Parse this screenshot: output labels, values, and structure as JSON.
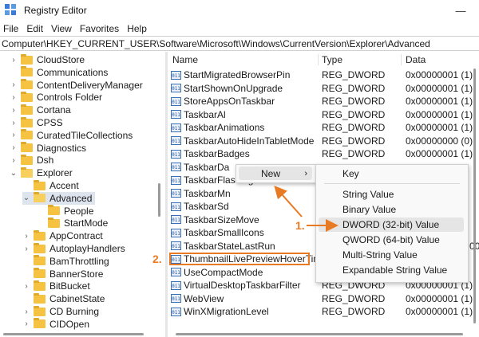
{
  "window": {
    "title": "Registry Editor"
  },
  "menu": [
    "File",
    "Edit",
    "View",
    "Favorites",
    "Help"
  ],
  "address": "Computer\\HKEY_CURRENT_USER\\Software\\Microsoft\\Windows\\CurrentVersion\\Explorer\\Advanced",
  "tree": [
    {
      "label": "CloudStore",
      "level": 0,
      "chev": "›"
    },
    {
      "label": "Communications",
      "level": 0,
      "chev": ""
    },
    {
      "label": "ContentDeliveryManager",
      "level": 0,
      "chev": "›"
    },
    {
      "label": "Controls Folder",
      "level": 0,
      "chev": "›"
    },
    {
      "label": "Cortana",
      "level": 0,
      "chev": "›"
    },
    {
      "label": "CPSS",
      "level": 0,
      "chev": "›"
    },
    {
      "label": "CuratedTileCollections",
      "level": 0,
      "chev": "›"
    },
    {
      "label": "Diagnostics",
      "level": 0,
      "chev": "›"
    },
    {
      "label": "Dsh",
      "level": 0,
      "chev": "›"
    },
    {
      "label": "Explorer",
      "level": 0,
      "chev": "⌄"
    },
    {
      "label": "Accent",
      "level": 1,
      "chev": ""
    },
    {
      "label": "Advanced",
      "level": 1,
      "chev": "⌄",
      "selected": true
    },
    {
      "label": "People",
      "level": 2,
      "chev": ""
    },
    {
      "label": "StartMode",
      "level": 2,
      "chev": ""
    },
    {
      "label": "AppContract",
      "level": 1,
      "chev": "›"
    },
    {
      "label": "AutoplayHandlers",
      "level": 1,
      "chev": "›"
    },
    {
      "label": "BamThrottling",
      "level": 1,
      "chev": ""
    },
    {
      "label": "BannerStore",
      "level": 1,
      "chev": ""
    },
    {
      "label": "BitBucket",
      "level": 1,
      "chev": "›"
    },
    {
      "label": "CabinetState",
      "level": 1,
      "chev": ""
    },
    {
      "label": "CD Burning",
      "level": 1,
      "chev": "›"
    },
    {
      "label": "CIDOpen",
      "level": 1,
      "chev": "›"
    }
  ],
  "columns": {
    "name": "Name",
    "type": "Type",
    "data": "Data"
  },
  "values": [
    {
      "name": "StartMigratedBrowserPin",
      "type": "REG_DWORD",
      "data": "0x00000001 (1)"
    },
    {
      "name": "StartShownOnUpgrade",
      "type": "REG_DWORD",
      "data": "0x00000001 (1)"
    },
    {
      "name": "StoreAppsOnTaskbar",
      "type": "REG_DWORD",
      "data": "0x00000001 (1)"
    },
    {
      "name": "TaskbarAl",
      "type": "REG_DWORD",
      "data": "0x00000001 (1)"
    },
    {
      "name": "TaskbarAnimations",
      "type": "REG_DWORD",
      "data": "0x00000001 (1)"
    },
    {
      "name": "TaskbarAutoHideInTabletMode",
      "type": "REG_DWORD",
      "data": "0x00000000 (0)"
    },
    {
      "name": "TaskbarBadges",
      "type": "REG_DWORD",
      "data": "0x00000001 (1)"
    },
    {
      "name": "TaskbarDa",
      "type": "",
      "data": ""
    },
    {
      "name": "TaskbarFlashing",
      "type": "",
      "data": ""
    },
    {
      "name": "TaskbarMn",
      "type": "",
      "data": ""
    },
    {
      "name": "TaskbarSd",
      "type": "",
      "data": ""
    },
    {
      "name": "TaskbarSizeMove",
      "type": "",
      "data": ""
    },
    {
      "name": "TaskbarSmallIcons",
      "type": "",
      "data": ""
    },
    {
      "name": "TaskbarStateLastRun",
      "type": "",
      "data": "00"
    },
    {
      "name": "ThumbnailLivePreviewHoverTime",
      "type": "",
      "data": ""
    },
    {
      "name": "UseCompactMode",
      "type": "",
      "data": ""
    },
    {
      "name": "VirtualDesktopTaskbarFilter",
      "type": "REG_DWORD",
      "data": "0x00000001 (1)"
    },
    {
      "name": "WebView",
      "type": "REG_DWORD",
      "data": "0x00000001 (1)"
    },
    {
      "name": "WinXMigrationLevel",
      "type": "REG_DWORD",
      "data": "0x00000001 (1)"
    }
  ],
  "context_menu": {
    "new_label": "New",
    "arrow": "›"
  },
  "submenu": [
    "Key",
    "String Value",
    "Binary Value",
    "DWORD (32-bit) Value",
    "QWORD (64-bit) Value",
    "Multi-String Value",
    "Expandable String Value"
  ],
  "annotations": {
    "one": "1.",
    "two": "2."
  },
  "accent_color": "#e97a24"
}
